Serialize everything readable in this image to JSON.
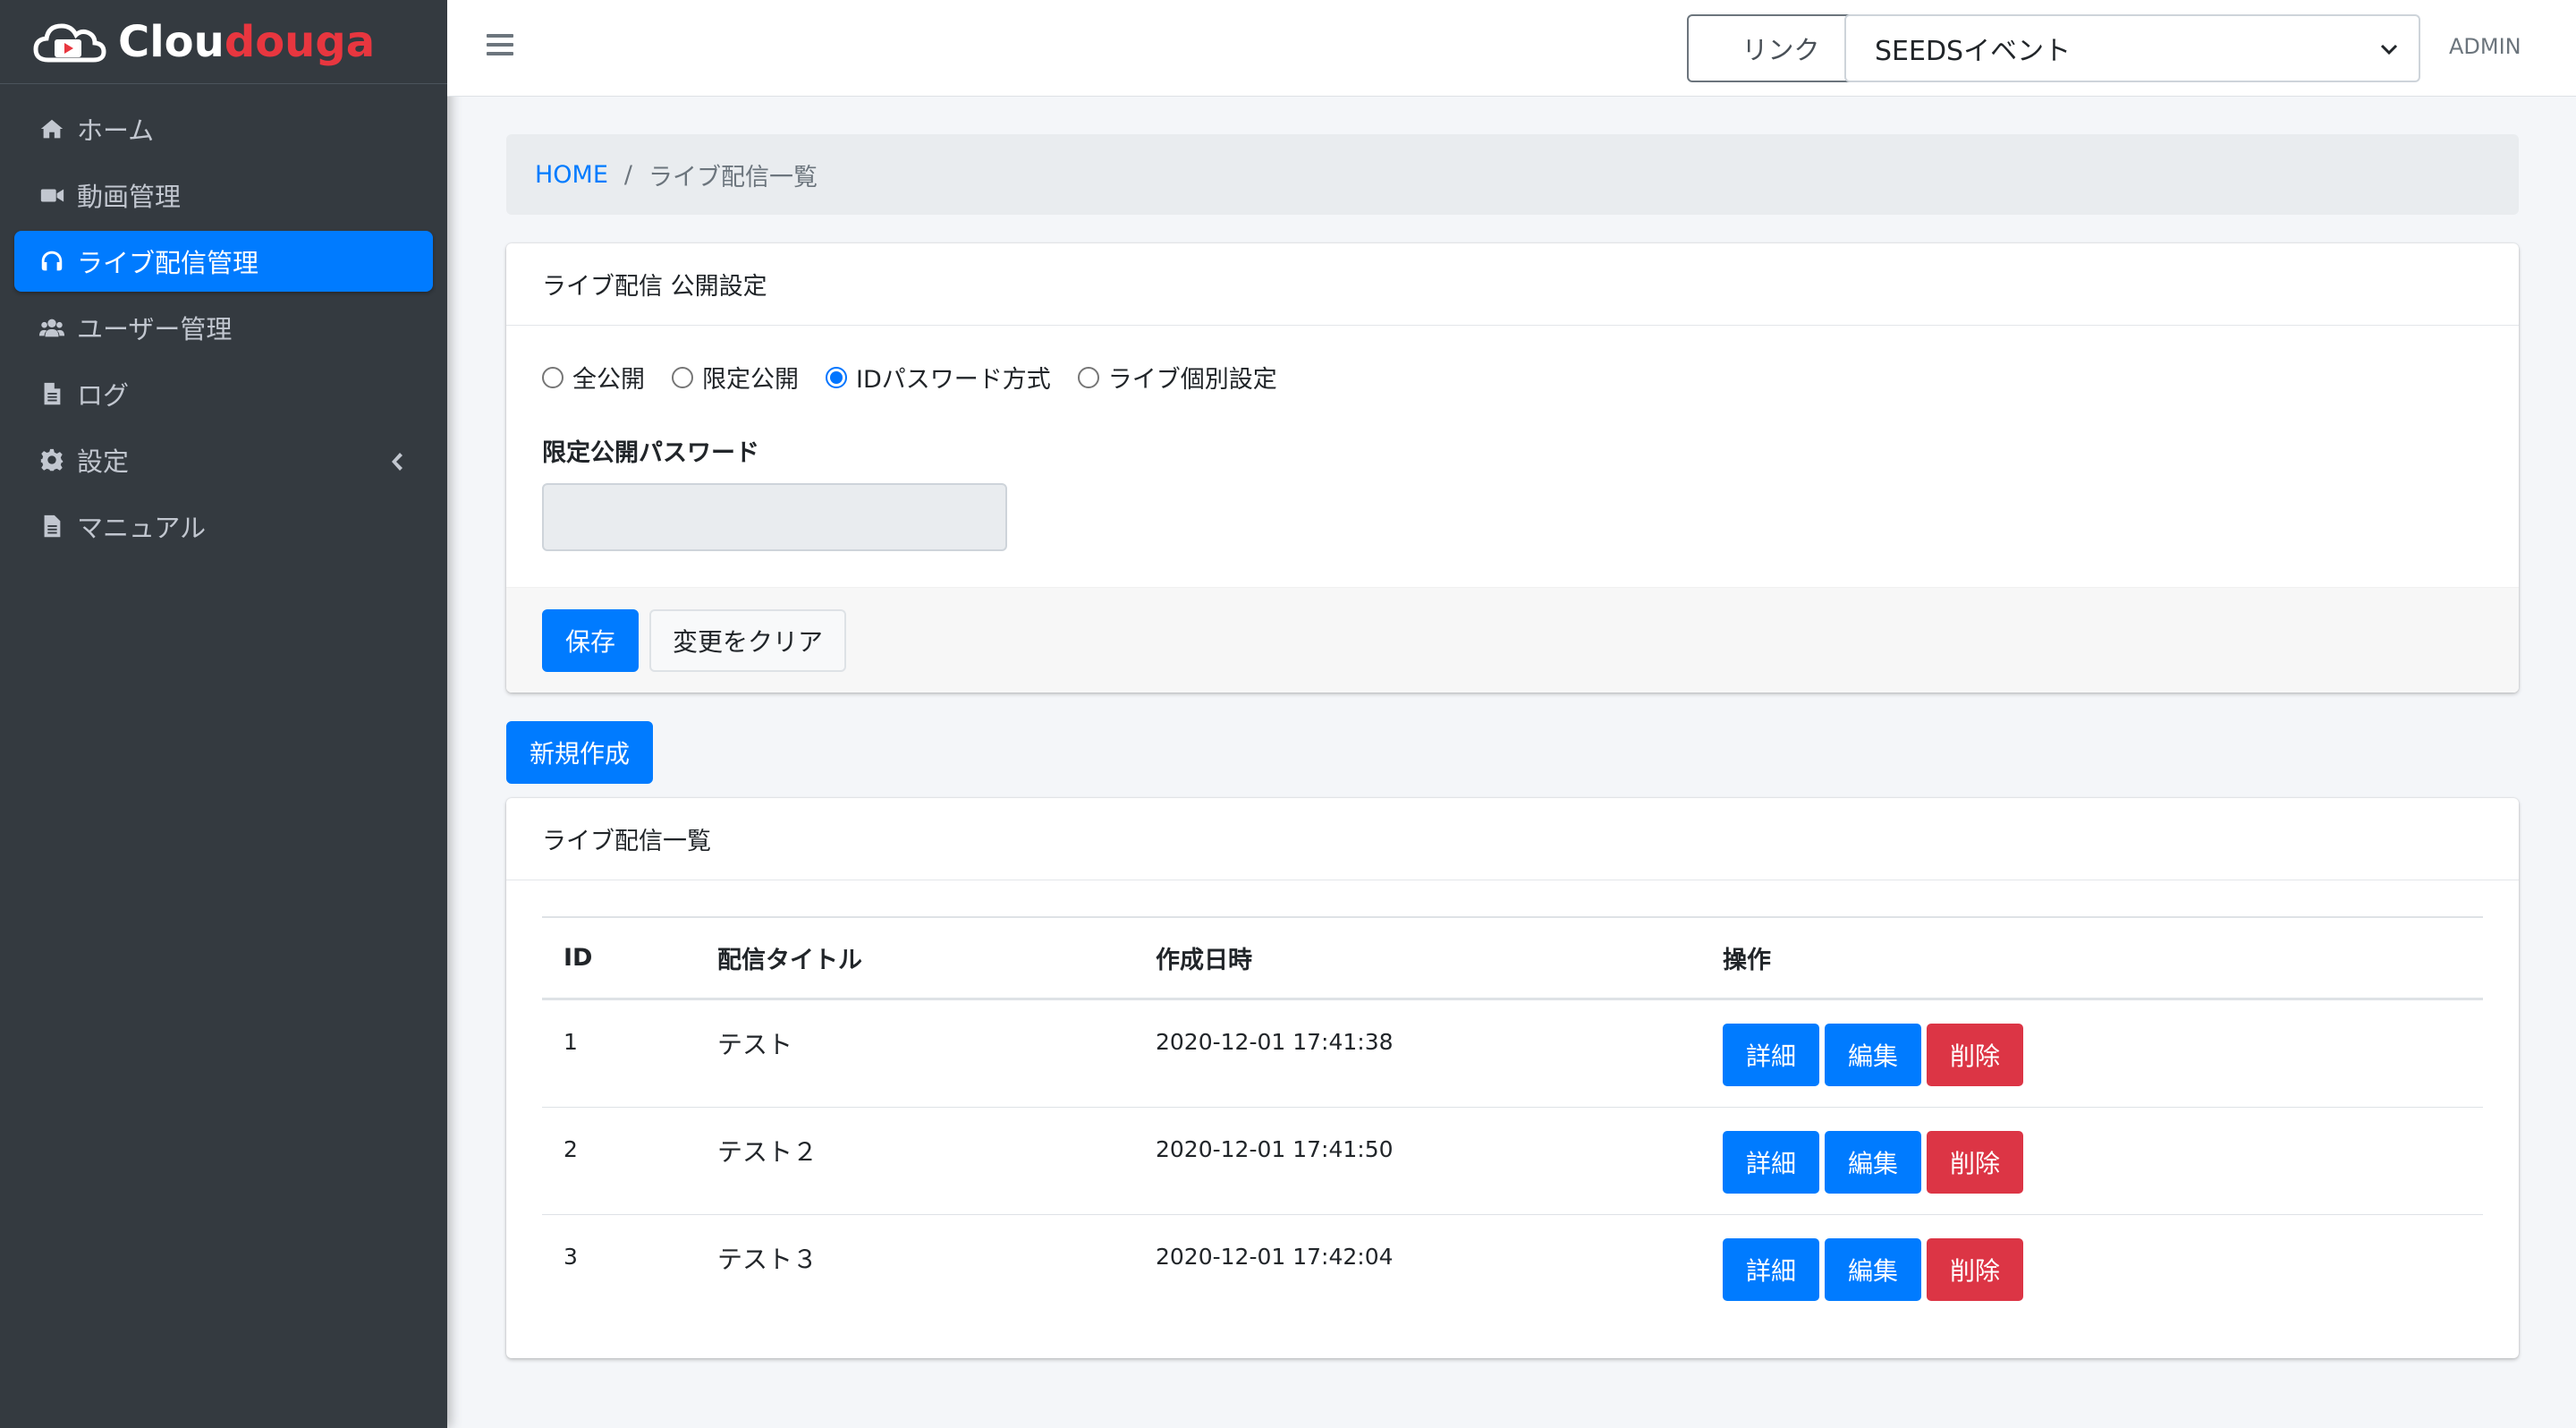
{
  "brand": {
    "name_part1": "Clou",
    "name_part2": "douga"
  },
  "sidebar": {
    "items": [
      {
        "label": "ホーム",
        "icon": "home-icon"
      },
      {
        "label": "動画管理",
        "icon": "video-icon"
      },
      {
        "label": "ライブ配信管理",
        "icon": "headset-icon",
        "active": true
      },
      {
        "label": "ユーザー管理",
        "icon": "users-icon"
      },
      {
        "label": "ログ",
        "icon": "file-icon"
      },
      {
        "label": "設定",
        "icon": "gear-icon",
        "has_chevron": true
      },
      {
        "label": "マニュアル",
        "icon": "file-icon"
      }
    ]
  },
  "topbar": {
    "link_label": "リンク",
    "event_select_value": "SEEDSイベント",
    "user_label": "ADMIN"
  },
  "breadcrumb": {
    "home": "HOME",
    "separator": "/",
    "current": "ライブ配信一覧"
  },
  "settings_card": {
    "title": "ライブ配信 公開設定",
    "radios": [
      {
        "label": "全公開",
        "checked": false
      },
      {
        "label": "限定公開",
        "checked": false
      },
      {
        "label": "IDパスワード方式",
        "checked": true
      },
      {
        "label": "ライブ個別設定",
        "checked": false
      }
    ],
    "password_label": "限定公開パスワード",
    "password_value": "",
    "save_label": "保存",
    "clear_label": "変更をクリア"
  },
  "new_button_label": "新規作成",
  "list_card": {
    "title": "ライブ配信一覧",
    "columns": [
      "ID",
      "配信タイトル",
      "作成日時",
      "操作"
    ],
    "rows": [
      {
        "id": "1",
        "title": "テスト",
        "created": "2020-12-01 17:41:38"
      },
      {
        "id": "2",
        "title": "テスト２",
        "created": "2020-12-01 17:41:50"
      },
      {
        "id": "3",
        "title": "テスト３",
        "created": "2020-12-01 17:42:04"
      }
    ],
    "actions": {
      "detail": "詳細",
      "edit": "編集",
      "delete": "削除"
    }
  },
  "colors": {
    "primary": "#007bff",
    "danger": "#dc3545",
    "sidebar_bg": "#343a40",
    "brand_red": "#e8363f"
  }
}
